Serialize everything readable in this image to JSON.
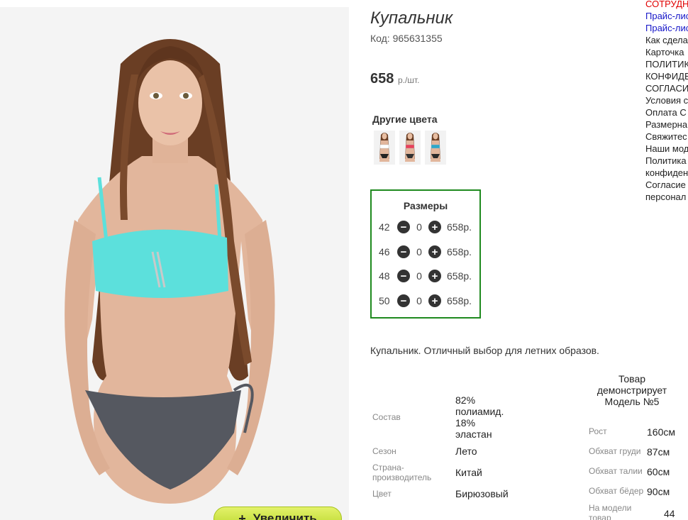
{
  "product": {
    "title": "Купальник",
    "code": "Код: 965631355",
    "price": "658",
    "price_unit": "р./шт.",
    "zoom_label": "Увеличить",
    "description": "Купальник. Отличный выбор для летних образов."
  },
  "colors": {
    "title": "Другие цвета",
    "swatches": [
      {
        "top": "#ffffff",
        "bottom": "#222222"
      },
      {
        "top": "#e8415a",
        "bottom": "#333333"
      },
      {
        "top": "#2fa7c8",
        "bottom": "#2a2a2a"
      }
    ]
  },
  "sizes": {
    "title": "Размеры",
    "rows": [
      {
        "size": "42",
        "qty": "0",
        "price": "658р."
      },
      {
        "size": "46",
        "qty": "0",
        "price": "658р."
      },
      {
        "size": "48",
        "qty": "0",
        "price": "658р."
      },
      {
        "size": "50",
        "qty": "0",
        "price": "658р."
      }
    ]
  },
  "specs": [
    {
      "label": "Состав",
      "value_lines": [
        "82%",
        "полиамид.",
        "18%",
        "эластан"
      ]
    },
    {
      "label": "Сезон",
      "value_lines": [
        "Лето"
      ]
    },
    {
      "label_lines": [
        "Страна-",
        "производитель"
      ],
      "value_lines": [
        "Китай"
      ]
    },
    {
      "label": "Цвет",
      "value_lines": [
        "Бирюзовый"
      ]
    }
  ],
  "model": {
    "heading_lines": [
      "Товар",
      "демонстрирует",
      "Модель №5"
    ],
    "rows": [
      {
        "label": "Рост",
        "value": "160см"
      },
      {
        "label": "Обхват груди",
        "value": "87см"
      },
      {
        "label": "Обхват талии",
        "value": "60см"
      },
      {
        "label": "Обхват бёдер",
        "value": "90см"
      },
      {
        "label_lines": [
          "На модели",
          "товар"
        ],
        "value": "44"
      }
    ]
  },
  "side_menu": [
    {
      "text": "СОТРУДН",
      "style": "red"
    },
    {
      "text": "Прайс-лис",
      "style": "blue"
    },
    {
      "text": "Прайс-лис",
      "style": "blue"
    },
    {
      "text": "Как сдела",
      "style": "plain"
    },
    {
      "text": "Карточка",
      "style": "plain"
    },
    {
      "text": "ПОЛИТИК",
      "style": "plain"
    },
    {
      "text": "КОНФИДЕ",
      "style": "plain"
    },
    {
      "text": "СОГЛАСИ",
      "style": "plain"
    },
    {
      "text": "Условия с",
      "style": "plain"
    },
    {
      "text": "Оплата С",
      "style": "plain"
    },
    {
      "text": "Размерна",
      "style": "plain"
    },
    {
      "text": "Свяжитес",
      "style": "plain"
    },
    {
      "text": "Наши мод",
      "style": "plain"
    },
    {
      "text": "Политика",
      "style": "plain"
    },
    {
      "text": "конфиден",
      "style": "plain"
    },
    {
      "text": "Согласие",
      "style": "plain"
    },
    {
      "text": "персонал",
      "style": "plain"
    }
  ],
  "theme": {
    "sizes_border": "#1f8a1f",
    "zoom_button": "#c8e040",
    "swimsuit_top": "#5ce0dc",
    "swimsuit_bottom": "#555860"
  }
}
